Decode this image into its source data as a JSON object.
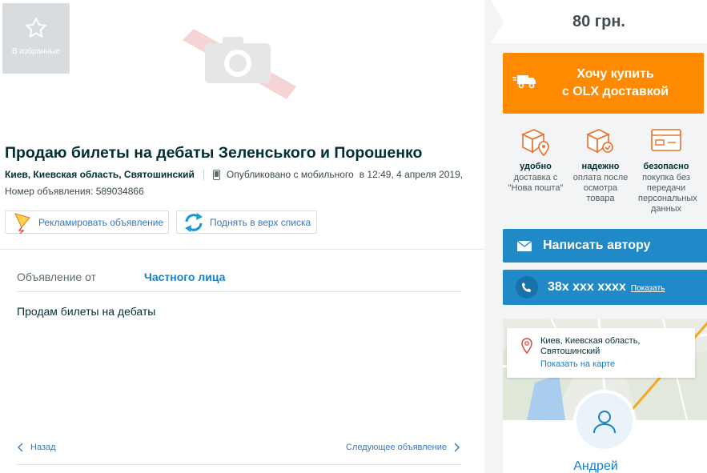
{
  "favorite": {
    "label": "В избранные"
  },
  "ad": {
    "title": "Продаю билеты на дебаты Зеленського и Порошенко",
    "location": "Киев, Киевская область, Святошинский",
    "published": "Опубликовано с мобильного",
    "published_time": "в 12:49, 4 апреля 2019,",
    "ad_number": "Номер объявления: 589034866",
    "promote_label": "Рекламировать объявление",
    "raise_label": "Поднять в верх списка",
    "from_key": "Объявление от",
    "from_value": "Частного лица",
    "description": "Продам билеты на дебаты",
    "prev_label": "Назад",
    "next_label": "Следующее объявление"
  },
  "sidebar": {
    "price": "80 грн.",
    "buy_line1": "Хочу купить",
    "buy_line2": "с OLX доставкой",
    "features": [
      {
        "title": "удобно",
        "desc": "доставка с \"Нова пошта\"",
        "icon": "box-location-icon"
      },
      {
        "title": "надежно",
        "desc": "оплата после осмотра товара",
        "icon": "box-check-icon"
      },
      {
        "title": "безопасно",
        "desc": "покупка без передачи персональных данных",
        "icon": "card-icon"
      }
    ],
    "message_label": "Написать автору",
    "phone_masked": "38х ххх хххх",
    "phone_show": "Показать",
    "map_address": "Киев, Киевская область, Святошинский",
    "map_link": "Показать на карте",
    "user_name": "Андрей"
  },
  "colors": {
    "orange": "#ff8a00",
    "blue": "#1f8ac7",
    "link": "#1a7ec4",
    "sidebar_bg": "#f2f4f5"
  }
}
